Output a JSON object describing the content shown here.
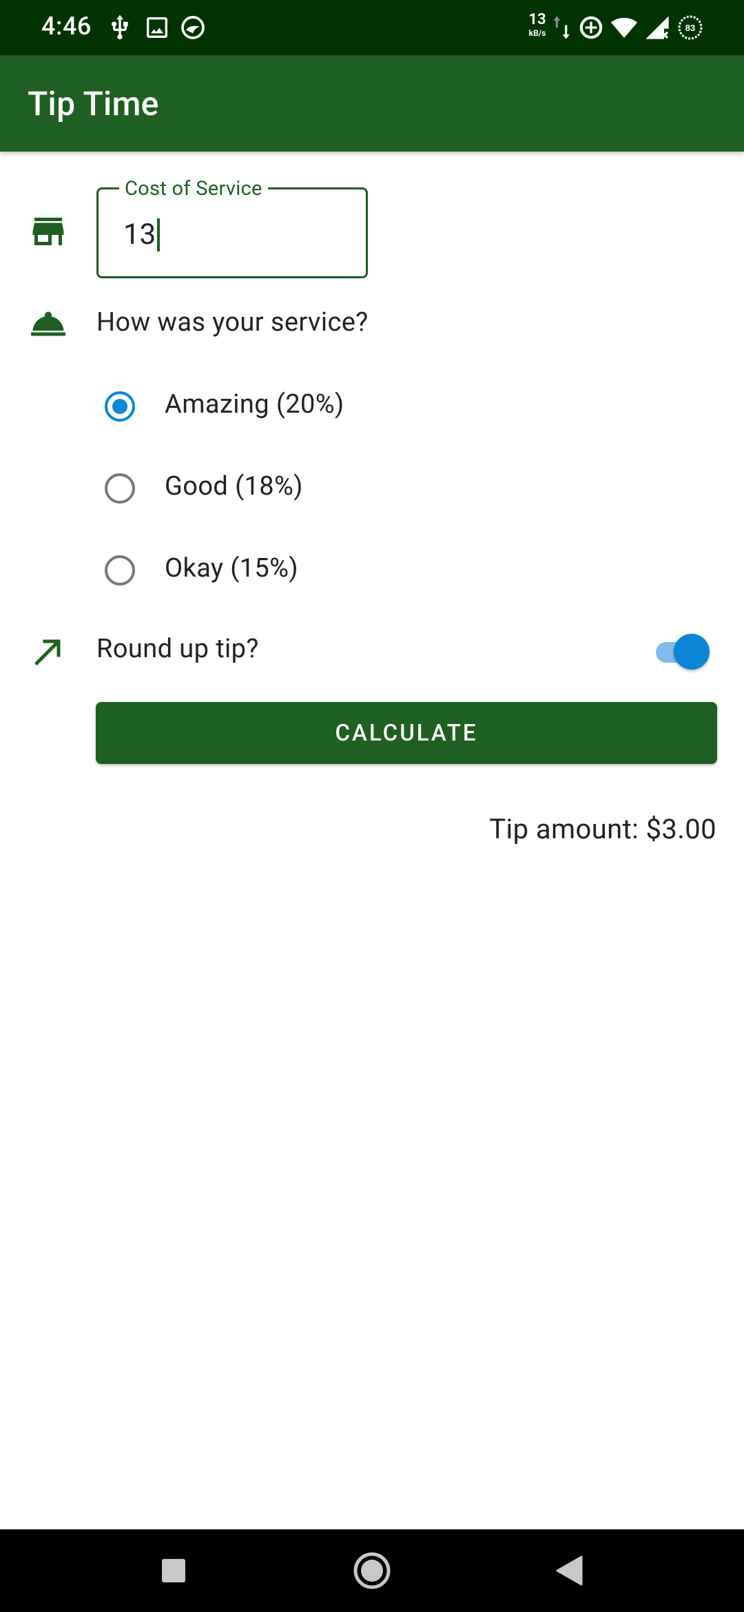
{
  "status_bar": {
    "time": "4:46",
    "net_speed_value": "13",
    "net_speed_unit": "kB/s",
    "battery_level": "83",
    "left_icons": [
      "usb-icon",
      "image-icon",
      "sync-icon"
    ],
    "right_icons": [
      "data-transfer-icon",
      "data-saver-icon",
      "wifi-icon",
      "signal-icon",
      "battery-icon"
    ]
  },
  "app_bar": {
    "title": "Tip Time"
  },
  "cost_field": {
    "label": "Cost of Service",
    "value": "13",
    "icon": "store-icon"
  },
  "service": {
    "question": "How was your service?",
    "icon": "room-service-bell-icon",
    "options": [
      {
        "label": "Amazing (20%)",
        "checked": true
      },
      {
        "label": "Good (18%)",
        "checked": false
      },
      {
        "label": "Okay (15%)",
        "checked": false
      }
    ]
  },
  "round_up": {
    "label": "Round up tip?",
    "enabled": true,
    "icon": "trending-up-icon"
  },
  "calculate_button": {
    "label": "CALCULATE"
  },
  "result": {
    "text": "Tip amount: $3.00"
  },
  "colors": {
    "primary": "#1e5f22",
    "status_bar": "#003300",
    "accent": "#0b86d6",
    "nav_bar": "#000000"
  },
  "nav_bar": {
    "buttons": [
      "recents-square-icon",
      "home-circle-icon",
      "back-triangle-icon"
    ]
  }
}
